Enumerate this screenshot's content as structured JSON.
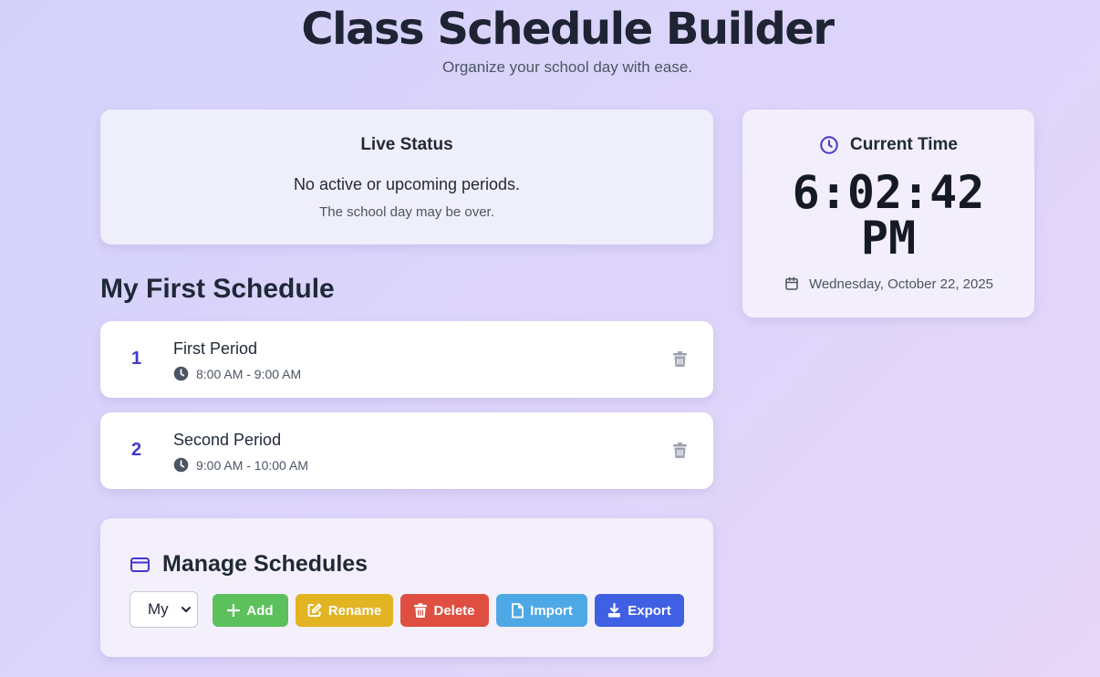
{
  "header": {
    "title": "Class Schedule Builder",
    "subtitle": "Organize your school day with ease."
  },
  "live_status": {
    "heading": "Live Status",
    "message": "No active or upcoming periods.",
    "submessage": "The school day may be over."
  },
  "clock": {
    "heading": "Current Time",
    "time": "6:02:42",
    "ampm": "PM",
    "date": "Wednesday, October 22, 2025",
    "icons": [
      "clock-icon",
      "calendar-icon"
    ]
  },
  "schedule": {
    "title": "My First Schedule",
    "periods": [
      {
        "number": "1",
        "name": "First Period",
        "time": "8:00 AM - 9:00 AM"
      },
      {
        "number": "2",
        "name": "Second Period",
        "time": "9:00 AM - 10:00 AM"
      }
    ]
  },
  "manage": {
    "heading": "Manage Schedules",
    "selected_schedule": "My",
    "buttons": {
      "add": "Add",
      "rename": "Rename",
      "delete": "Delete",
      "import": "Import",
      "export": "Export"
    }
  },
  "colors": {
    "accent": "#4338ca",
    "add": "#5cc05c",
    "rename": "#e2b323",
    "delete": "#df4f41",
    "import": "#4ea8e6",
    "export": "#4060e4"
  }
}
